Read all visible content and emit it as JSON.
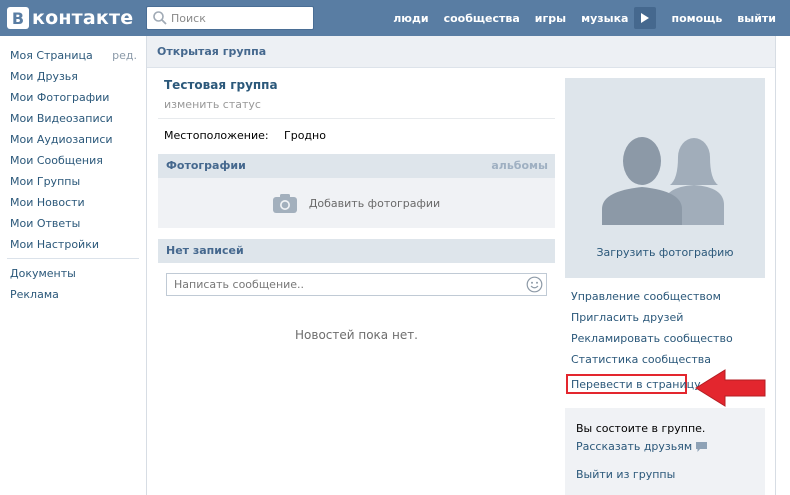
{
  "header": {
    "logo_letter": "В",
    "logo_text": "контакте",
    "search_placeholder": "Поиск",
    "nav": [
      "люди",
      "сообщества",
      "игры",
      "музыка",
      "помощь",
      "выйти"
    ]
  },
  "sidebar": {
    "items": [
      {
        "label": "Моя Страница"
      },
      {
        "label": "Мои Друзья"
      },
      {
        "label": "Мои Фотографии"
      },
      {
        "label": "Мои Видеозаписи"
      },
      {
        "label": "Мои Аудиозаписи"
      },
      {
        "label": "Мои Сообщения"
      },
      {
        "label": "Мои Группы"
      },
      {
        "label": "Мои Новости"
      },
      {
        "label": "Мои Ответы"
      },
      {
        "label": "Мои Настройки"
      }
    ],
    "edit_label": "ред.",
    "extra": [
      {
        "label": "Документы"
      },
      {
        "label": "Реклама"
      }
    ]
  },
  "page": {
    "title": "Открытая группа"
  },
  "group": {
    "name": "Тестовая группа",
    "status": "изменить статус",
    "location_label": "Местоположение:",
    "location_value": "Гродно"
  },
  "photos": {
    "title": "Фотографии",
    "albums_link": "альбомы",
    "add_label": "Добавить фотографии"
  },
  "posts": {
    "title": "Нет записей",
    "input_placeholder": "Написать сообщение..",
    "empty_text": "Новостей пока нет."
  },
  "right": {
    "upload_photo": "Загрузить фотографию",
    "actions": [
      "Управление сообществом",
      "Пригласить друзей",
      "Рекламировать сообщество",
      "Статистика сообщества"
    ],
    "convert": "Перевести в страницу",
    "member_text": "Вы состоите в группе.",
    "tell_friends": "Рассказать друзьям",
    "leave": "Выйти из группы"
  },
  "colors": {
    "header_bg": "#597da3",
    "link": "#2b587a",
    "highlight": "#e3262e"
  }
}
